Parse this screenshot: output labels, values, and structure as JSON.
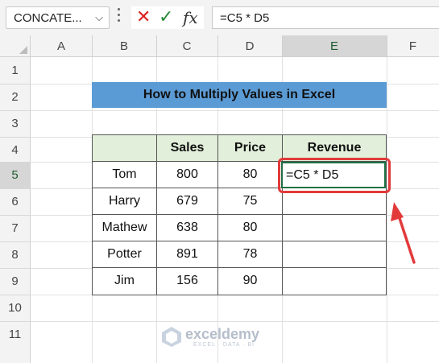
{
  "formula_bar": {
    "name_box": "CONCATE...",
    "formula": "=C5 * D5",
    "cancel_icon": "close-icon",
    "enter_icon": "check-icon",
    "fx_label": "fx"
  },
  "columns": [
    "A",
    "B",
    "C",
    "D",
    "E",
    "F"
  ],
  "rows": [
    "1",
    "2",
    "3",
    "4",
    "5",
    "6",
    "7",
    "8",
    "9",
    "10",
    "11"
  ],
  "title": "How to Multiply Values in Excel",
  "table": {
    "headers": [
      "",
      "Sales",
      "Price",
      "Revenue"
    ],
    "rows": [
      {
        "name": "Tom",
        "sales": "800",
        "price": "80",
        "revenue": "=C5 * D5"
      },
      {
        "name": "Harry",
        "sales": "679",
        "price": "75",
        "revenue": ""
      },
      {
        "name": "Mathew",
        "sales": "638",
        "price": "80",
        "revenue": ""
      },
      {
        "name": "Potter",
        "sales": "891",
        "price": "78",
        "revenue": ""
      },
      {
        "name": "Jim",
        "sales": "156",
        "price": "90",
        "revenue": ""
      }
    ]
  },
  "watermark": {
    "name": "exceldemy",
    "tagline": "EXCEL · DATA · BI"
  },
  "colors": {
    "title_bg": "#5b9bd5",
    "header_bg": "#e2efda",
    "highlight": "#e23a3a"
  }
}
